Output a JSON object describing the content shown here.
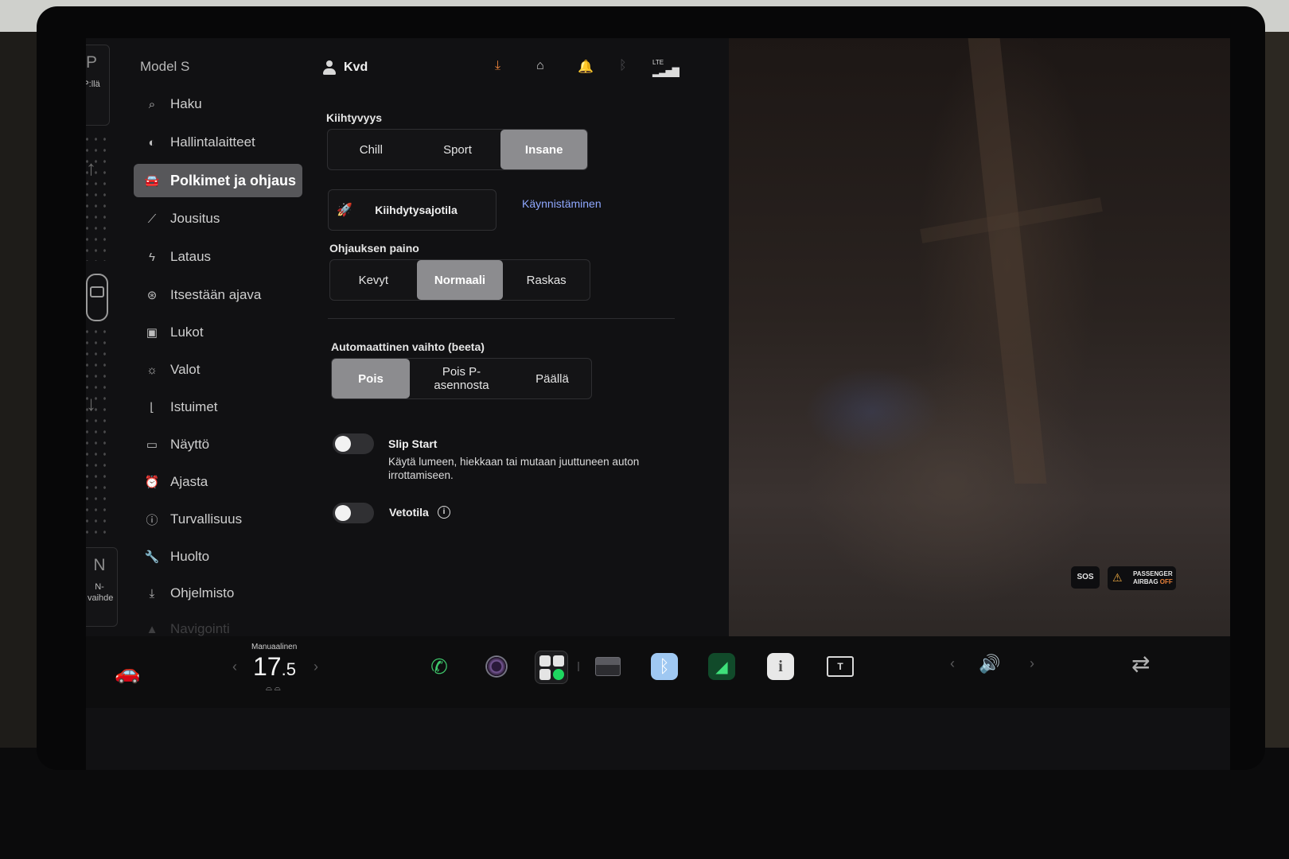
{
  "gear": {
    "park_letter": "P",
    "park_label": "P:llä",
    "neutral_letter": "N",
    "neutral_label": "N-vaihde"
  },
  "sidebar": {
    "title": "Model S",
    "items": [
      {
        "label": "Haku",
        "icon": "search-icon"
      },
      {
        "label": "Hallintalaitteet",
        "icon": "toggle-icon"
      },
      {
        "label": "Polkimet ja ohjaus",
        "icon": "car-icon",
        "active": true
      },
      {
        "label": "Jousitus",
        "icon": "wrench-icon"
      },
      {
        "label": "Lataus",
        "icon": "bolt-icon"
      },
      {
        "label": "Itsestään ajava",
        "icon": "steering-wheel-icon"
      },
      {
        "label": "Lukot",
        "icon": "lock-icon"
      },
      {
        "label": "Valot",
        "icon": "sun-icon"
      },
      {
        "label": "Istuimet",
        "icon": "seat-icon"
      },
      {
        "label": "Näyttö",
        "icon": "display-icon"
      },
      {
        "label": "Ajasta",
        "icon": "alarm-clock-icon"
      },
      {
        "label": "Turvallisuus",
        "icon": "alert-circle-icon"
      },
      {
        "label": "Huolto",
        "icon": "wrench-icon"
      },
      {
        "label": "Ohjelmisto",
        "icon": "download-icon"
      },
      {
        "label": "Navigointi",
        "icon": "navigation-icon"
      }
    ]
  },
  "topbar": {
    "user_name": "Kvd",
    "network_label": "LTE"
  },
  "acceleration": {
    "label": "Kiihtyvyys",
    "options": [
      "Chill",
      "Sport",
      "Insane"
    ],
    "selected": "Insane"
  },
  "launch": {
    "button_label": "Kiihdytysajotila",
    "link_label": "Käynnistäminen"
  },
  "steering": {
    "label": "Ohjauksen paino",
    "options": [
      "Kevyt",
      "Normaali",
      "Raskas"
    ],
    "selected": "Normaali"
  },
  "auto_shift": {
    "label": "Automaattinen vaihto (beeta)",
    "options": [
      "Pois",
      "Pois P-asennosta",
      "Päällä"
    ],
    "selected": "Pois"
  },
  "slip_start": {
    "title": "Slip Start",
    "description": "Käytä lumeen, hiekkaan tai mutaan juuttuneen auton irrottamiseen.",
    "enabled": false
  },
  "traction": {
    "title": "Vetotila",
    "enabled": false
  },
  "badges": {
    "sos": "SOS",
    "airbag_line1": "PASSENGER",
    "airbag_line2": "AIRBAG",
    "airbag_state": "OFF"
  },
  "taskbar": {
    "climate_mode": "Manuaalinen",
    "temp_whole": "17",
    "temp_decimal": ".5",
    "apps": [
      "phone-icon",
      "camera-icon",
      "launcher-icon",
      "dashcam-icon",
      "bluetooth-icon",
      "energy-icon",
      "manual-icon",
      "toybox-icon"
    ]
  },
  "colors": {
    "accent_orange": "#e8813a",
    "link_blue": "#8fa8ff",
    "selected_segment": "#8c8c8f"
  }
}
